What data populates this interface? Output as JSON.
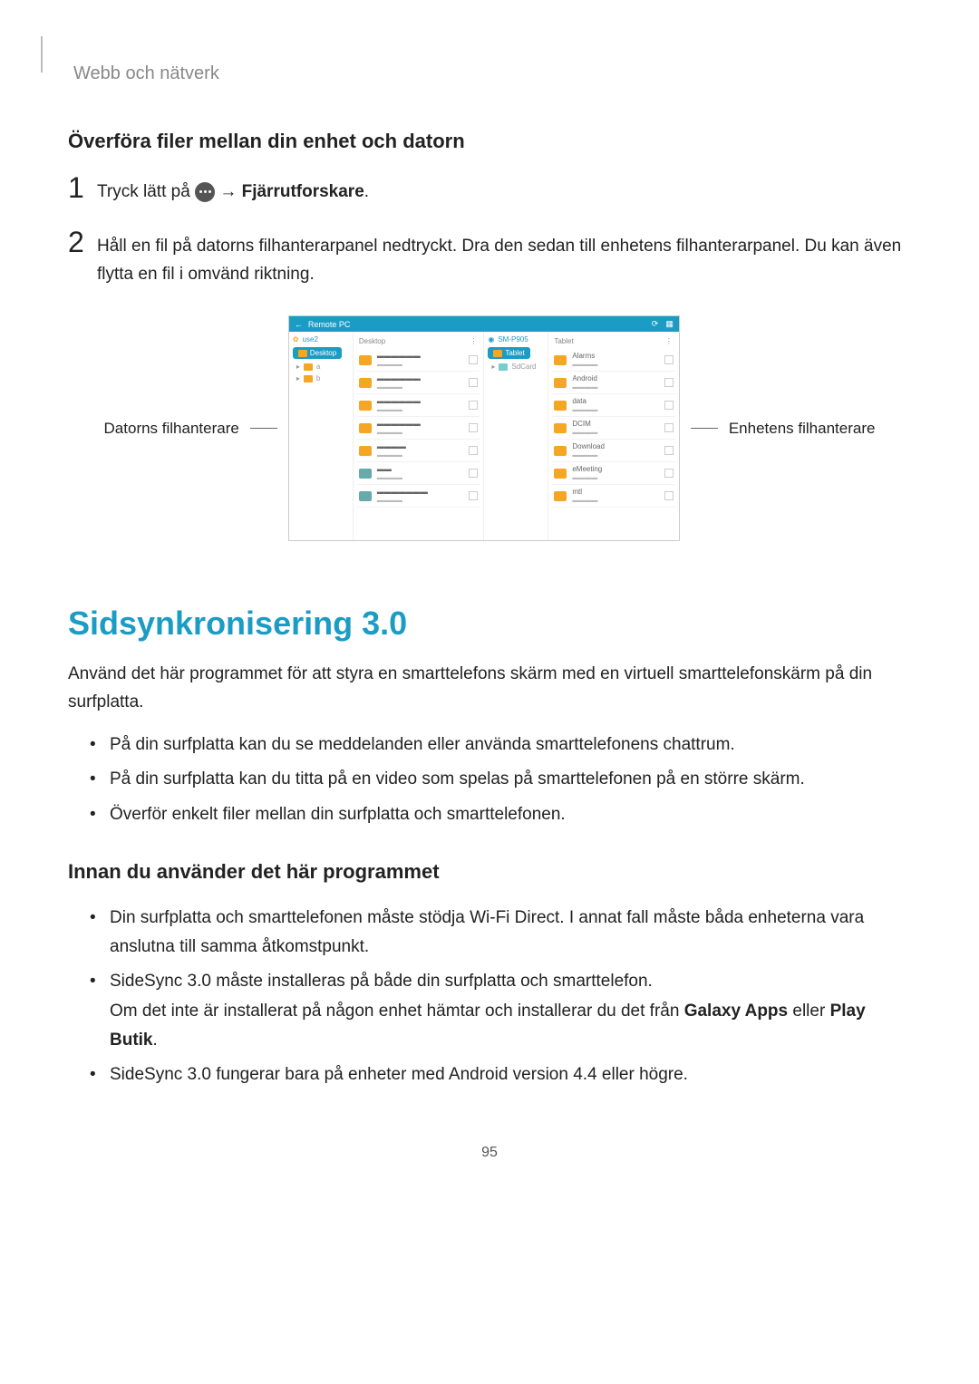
{
  "chapter": "Webb och nätverk",
  "subhead1": "Överföra filer mellan din enhet och datorn",
  "step1": {
    "pre": "Tryck lätt på ",
    "arrow": "→",
    "bold_target": "Fjärrutforskare",
    "period": "."
  },
  "step2": "Håll en fil på datorns filhanterarpanel nedtryckt. Dra den sedan till enhetens filhanterarpanel. Du kan även flytta en fil i omvänd riktning.",
  "callouts": {
    "left": "Datorns filhanterare",
    "right": "Enhetens filhanterare"
  },
  "fm": {
    "title": "Remote PC",
    "left_tree_header": "use2",
    "left_tree_badge": "Desktop",
    "left_items": [
      "a",
      "b"
    ],
    "left_list_header": "Desktop",
    "right_tree_header": "SM-P905",
    "right_tree_badge": "Tablet",
    "right_tree_sub": "SdCard",
    "right_list_header": "Tablet",
    "right_names": [
      "Alarms",
      "Android",
      "data",
      "DCIM",
      "Download",
      "eMeeting",
      "mtl"
    ]
  },
  "section_title": "Sidsynkronisering 3.0",
  "section_intro": "Använd det här programmet för att styra en smarttelefons skärm med en virtuell smarttelefonskärm på din surfplatta.",
  "bullets_a": [
    "På din surfplatta kan du se meddelanden eller använda smarttelefonens chattrum.",
    "På din surfplatta kan du titta på en video som spelas på smarttelefonen på en större skärm.",
    "Överför enkelt filer mellan din surfplatta och smarttelefonen."
  ],
  "subhead2": "Innan du använder det här programmet",
  "bullets_b": [
    {
      "text": "Din surfplatta och smarttelefonen måste stödja Wi-Fi Direct. I annat fall måste båda enheterna vara anslutna till samma åtkomstpunkt."
    },
    {
      "text": "SideSync 3.0 måste installeras på både din surfplatta och smarttelefon.",
      "extra_pre": "Om det inte är installerat på någon enhet hämtar och installerar du det från ",
      "extra_bold1": "Galaxy Apps",
      "extra_mid": " eller ",
      "extra_bold2": "Play Butik",
      "extra_post": "."
    },
    {
      "text": "SideSync 3.0 fungerar bara på enheter med Android version 4.4 eller högre."
    }
  ],
  "page_number": "95"
}
